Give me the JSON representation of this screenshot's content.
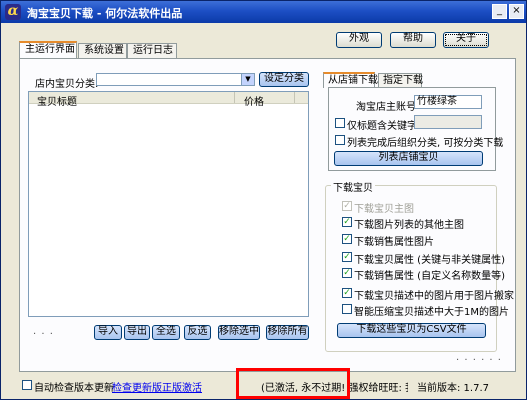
{
  "window": {
    "title": "淘宝宝贝下载 - 何尔法软件出品",
    "minimize_glyph": "_",
    "close_glyph": "×"
  },
  "top_buttons": {
    "skin": "外观",
    "help": "帮助",
    "about": "关于"
  },
  "main_tabs": [
    {
      "label": "主运行界面",
      "active": true
    },
    {
      "label": "系统设置",
      "active": false
    },
    {
      "label": "运行日志",
      "active": false
    }
  ],
  "category": {
    "label": "店内宝贝分类:",
    "value": "",
    "set_button": "设定分类"
  },
  "list": {
    "columns": [
      "宝贝标题",
      "价格"
    ],
    "rows": []
  },
  "list_buttons": {
    "import": "导入",
    "export": "导出",
    "select_all": "全选",
    "invert": "反选",
    "remove_selected": "移除选中",
    "remove_all": "移除所有"
  },
  "dots_left": ". . .",
  "dots_right": ". . . . . .",
  "download_tabs": [
    {
      "label": "从店铺下载",
      "active": true
    },
    {
      "label": "指定下载",
      "active": false
    }
  ],
  "shop_download": {
    "account_label": "淘宝店主账号",
    "account_value": "竹楼绿茶",
    "keyword_checkbox": "仅标题含关键字",
    "keyword_checked": false,
    "keyword_value": "",
    "group_checkbox": "列表完成后组织分类, 可按分类下载",
    "group_checked": false,
    "list_button": "列表店铺宝贝"
  },
  "download_group": {
    "title": "下载宝贝",
    "options": [
      {
        "label": "下载宝贝主图",
        "checked": true,
        "disabled": true
      },
      {
        "label": "下载图片列表的其他主图",
        "checked": true,
        "disabled": false
      },
      {
        "label": "下载销售属性图片",
        "checked": true,
        "disabled": false
      },
      {
        "label": "下载宝贝属性 (关键与非关键属性)",
        "checked": true,
        "disabled": false
      },
      {
        "label": "下载销售属性 (自定义名称数量等)",
        "checked": true,
        "disabled": false
      },
      {
        "label": "下载宝贝描述中的图片用于图片搬家",
        "checked": true,
        "disabled": false
      },
      {
        "label": "智能压缩宝贝描述中大于1M的图片",
        "checked": false,
        "disabled": false
      }
    ],
    "csv_button": "下载这些宝贝为CSV文件"
  },
  "footer": {
    "auto_check_label": "自动检查版本更新",
    "auto_check_checked": false,
    "check_update_link": "检查更新版",
    "activate_link": "正版激活",
    "status_text": "(已激活, 永不过期! 强权给旺旺: 我爱重做的)",
    "version_text": "当前版本: 1.7.7"
  }
}
